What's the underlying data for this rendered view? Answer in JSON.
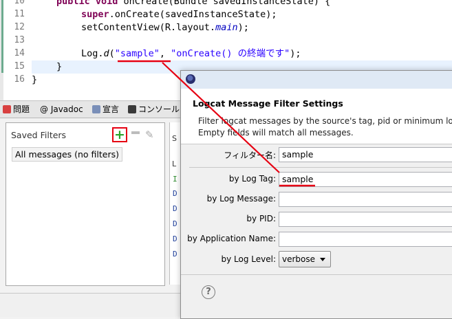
{
  "editor": {
    "line_numbers": [
      "10",
      "11",
      "12",
      "13",
      "14",
      "15",
      "16"
    ],
    "line10": {
      "kw": "public void",
      "method": "onCreate",
      "rest": "(Bundle savedInstanceState) {"
    },
    "line11": {
      "kw": "super",
      "rest": ".onCreate(savedInstanceState);"
    },
    "line12": {
      "pre": "setContentView(R.layout.",
      "field": "main",
      "post": ");"
    },
    "line14": {
      "pre": "Log.",
      "method": "d",
      "open": "(",
      "tag": "\"sample\"",
      "comma": ", ",
      "msg": "\"onCreate() の終端です\"",
      "close": ");"
    },
    "line15": "}",
    "line16": "}"
  },
  "tabs": {
    "problems": "問題",
    "javadoc": "@ Javadoc",
    "declaration": "宣言",
    "console": "コンソール"
  },
  "saved_filters": {
    "title": "Saved Filters",
    "add_icon": "+",
    "items": [
      "All messages (no filters)"
    ]
  },
  "log_table": {
    "header_s": "S",
    "header_l": "L",
    "rows": [
      "I",
      "D",
      "D",
      "D",
      "D",
      "D"
    ]
  },
  "dialog": {
    "title_icon": "eclipse-icon",
    "heading": "Logcat Message Filter Settings",
    "desc_line1": "Filter logcat messages by the source's tag, pid or minimum log",
    "desc_line2": "Empty fields will match all messages.",
    "filter_name_label": "フィルター名:",
    "filter_name_value": "sample",
    "log_tag_label": "by Log Tag:",
    "log_tag_value": "sample",
    "log_message_label": "by Log Message:",
    "log_message_value": "",
    "pid_label": "by PID:",
    "pid_value": "",
    "app_name_label": "by Application Name:",
    "app_name_value": "",
    "log_level_label": "by Log Level:",
    "log_level_value": "verbose",
    "help_symbol": "?"
  },
  "colors": {
    "annotation_red": "#e60012",
    "keyword": "#7f0055",
    "string": "#2a00ff",
    "add_green": "#2aa42a"
  }
}
